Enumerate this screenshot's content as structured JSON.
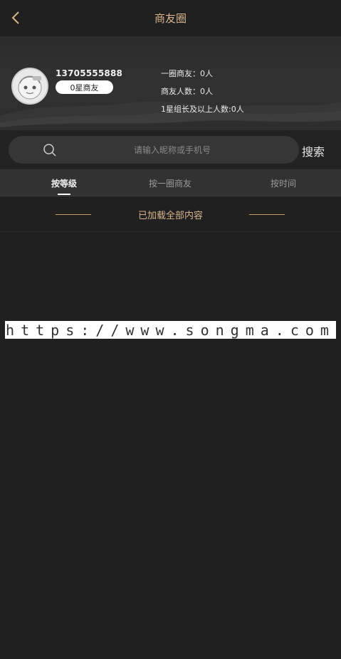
{
  "header": {
    "title": "商友圈",
    "back_icon": "chevron-left-icon"
  },
  "profile": {
    "phone": "13705555888",
    "level_badge": "0星商友",
    "stats": {
      "first_circle": "一圈商友：0人",
      "friends_count": "商友人数：0人",
      "leaders_count": "1星组长及以上人数:0人"
    }
  },
  "search": {
    "placeholder": "请输入昵称或手机号",
    "value": "",
    "button_label": "搜索",
    "icon": "search-icon"
  },
  "tabs": [
    {
      "label": "按等级",
      "active": true
    },
    {
      "label": "按一圈商友",
      "active": false
    },
    {
      "label": "按时间",
      "active": false
    }
  ],
  "list": {
    "status": "已加载全部内容"
  },
  "watermark": "https://www.songma.com",
  "colors": {
    "accent_gold": "#d7b48d",
    "background": "#202020",
    "tab_bar": "#323232"
  }
}
